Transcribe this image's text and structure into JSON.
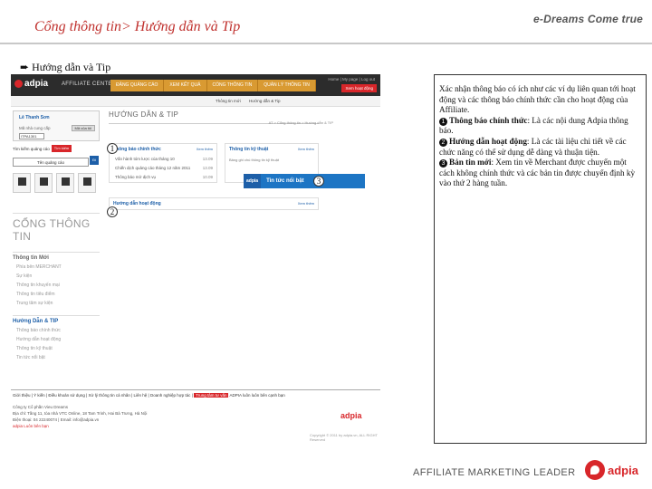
{
  "slide": {
    "title": "Cổng thông tin> Hướng dẫn và Tip",
    "slogan": "e-Dreams Come true",
    "section_heading": "Hướng dẫn và Tip",
    "footer_tagline": "AFFILIATE MARKETING LEADER",
    "footer_brand": "adpia"
  },
  "screenshot": {
    "logo": "adpia",
    "app_name": "AFFILIATE CENTER",
    "nav_tabs": [
      "ĐĂNG QUẢNG CÁO",
      "XEM KẾT QUẢ",
      "CỔNG THÔNG TIN",
      "QUẢN LÝ THÔNG TIN"
    ],
    "top_links": "Home | My page | Log out",
    "top_button": "Xem hoạt động",
    "sub_tabs": [
      "Thông tin mới",
      "Hướng dẫn & Tip"
    ],
    "sidebar": {
      "user_name": "Lê Thanh Sơn",
      "id_label": "Mã nhà cung cấp",
      "id_button": "Mã của tôi",
      "id_value": "ITPA1301",
      "ad_search_label": "Tìm kiếm quảng cáo",
      "ad_search_dropdown": "Tìm kiếm",
      "ad_input": "Tên quảng cáo",
      "ad_go": "Đi",
      "portal_title": "CỔNG THÔNG TIN",
      "menu": [
        {
          "head": "Thông tin Mới",
          "items": [
            "Phía bên MERCHANT",
            "Sự kiện",
            "Thông tin khuyến mại",
            "Thông tin tiêu điểm",
            "Trung tâm sự kiện"
          ]
        },
        {
          "head": "Hướng Dẫn & TIP",
          "items": [
            "Thông báo chính thức",
            "Hướng dẫn hoạt động",
            "Thông tin kỹ thuật",
            "Tin tức nổi bật"
          ]
        }
      ]
    },
    "main": {
      "page_title": "HƯỚNG DẪN & TIP",
      "breadcrumb": "AT > Cổng thông tin > Hướng dẫn & TIP",
      "notice_box": {
        "title": "Thông báo chính thức",
        "more": "Xem thêm",
        "rows": [
          {
            "text": "Vấn hành tóm lược của tháng 10",
            "date": "13.09"
          },
          {
            "text": "Chiến dịch quảng cáo tháng 12 năm 2011",
            "date": "13.09"
          },
          {
            "text": "Thông báo mở dịch vụ",
            "date": "10.09"
          }
        ]
      },
      "tech_box": {
        "title": "Thông tin kỹ thuật",
        "more": "Xem thêm",
        "sub": "Bảng ghi chú thông tin kỹ thuật"
      },
      "guide_box": {
        "title": "Hướng dẫn hoạt động",
        "more": "Xem thêm"
      },
      "news_banner": {
        "logo": "adpia",
        "text": "Tin tức nổi bật"
      }
    },
    "footer": {
      "links": [
        "Giới thiệu",
        "Ý kiến",
        "Điều khoản sử dụng",
        "Xử lý thông tin cá nhân",
        "Liên hệ",
        "Doanh nghiệp hợp tác",
        "Trung tâm tư vấn"
      ],
      "link_tail": "ADPIA luôn luôn bên cạnh bạn",
      "company": "Công ty Cổ phần Vieu Dreams",
      "address": "Địa chỉ: Tầng 11, tòa nhà VTC Online, 18 Tam Trinh, Hai Bà Trưng, Hà Nội",
      "phone": "Điện thoại: 04 22240074 | Email: info@adpia.vn",
      "slogan": "adpia Luôn bên bạn",
      "logo": "adpia",
      "copyright": "Copyright © 2011 by adpia.vn, ALL RIGHT Reserved"
    },
    "callouts": [
      "1",
      "2",
      "3"
    ]
  },
  "description": {
    "intro": "Xác nhận thông báo có ích như các ví dụ liên quan tới hoạt động và các thông báo chính thức cần cho hoạt động của Affiliate.",
    "items": [
      {
        "num": "1",
        "title": "Thông báo chính thức",
        "text": ": Là các nội dung Adpia thông báo."
      },
      {
        "num": "2",
        "title": "Hướng dẫn hoạt động",
        "text": ": Là các tài liệu chi tiết về các chức năng có thể sử dụng dễ dàng và thuận tiện."
      },
      {
        "num": "3",
        "title": "Bản tin mới",
        "text": ": Xem tin về Merchant được chuyển một cách không chính thức và các bản tin được chuyển định kỳ vào thứ 2 hàng tuần."
      }
    ]
  }
}
